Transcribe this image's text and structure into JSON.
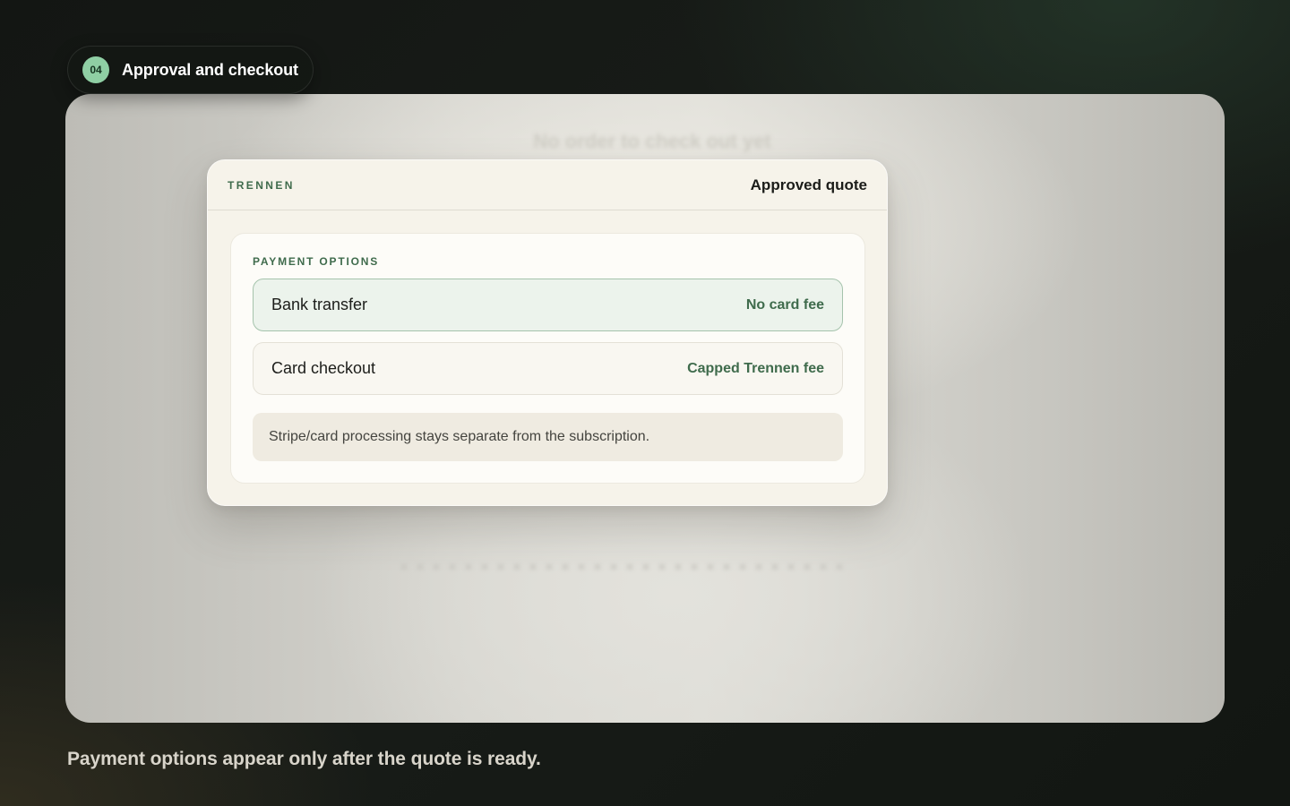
{
  "step": {
    "number": "04",
    "title": "Approval and checkout"
  },
  "background": {
    "ghost_text": "No order to check out yet"
  },
  "card": {
    "brand": "TRENNEN",
    "status": "Approved quote",
    "section_label": "PAYMENT OPTIONS",
    "options": [
      {
        "label": "Bank transfer",
        "note": "No card fee",
        "selected": true
      },
      {
        "label": "Card checkout",
        "note": "Capped Trennen fee",
        "selected": false
      }
    ],
    "info_note": "Stripe/card processing stays separate from the subscription."
  },
  "caption": "Payment options appear only after the quote is ready.",
  "colors": {
    "accent_green": "#3f6b4c",
    "step_badge": "#8fcfa4",
    "selected_bg": "#ecf3ec",
    "card_bg": "#f6f3ea"
  }
}
